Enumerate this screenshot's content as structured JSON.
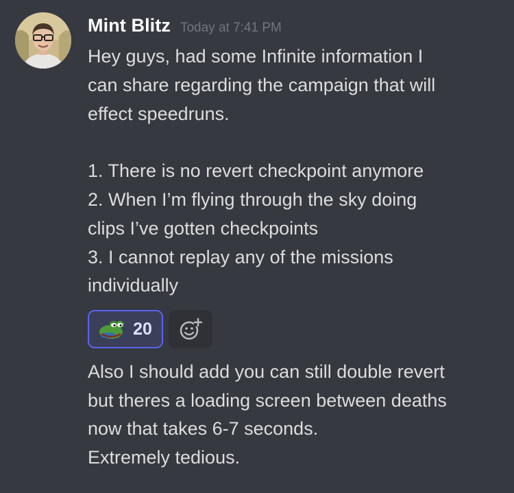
{
  "author": {
    "username": "Mint Blitz",
    "timestamp": "Today at 7:41 PM",
    "avatar_icon": "user-avatar-photo"
  },
  "message1": {
    "lines": [
      "Hey guys, had some Infinite information I",
      "can share regarding the campaign that will",
      "effect speedruns.",
      "1. There is no revert checkpoint anymore",
      "2. When I’m flying through the sky doing",
      "clips I’ve gotten checkpoints",
      "3. I cannot replay any of the missions",
      "individually"
    ]
  },
  "reactions": [
    {
      "emoji_icon": "pepe-frog-emoji",
      "count": "20",
      "active": true
    }
  ],
  "add_reaction_icon": "add-reaction-icon",
  "message2": {
    "lines": [
      "Also I should add you can still double revert",
      "but theres a loading screen between deaths",
      "now that takes 6-7 seconds.",
      "Extremely tedious."
    ]
  },
  "colors": {
    "background": "#36393f",
    "username": "#ffffff",
    "timestamp": "#72767d",
    "text": "#dcddde",
    "reaction_border": "#5865f2",
    "reaction_bg": "#3b405a"
  }
}
